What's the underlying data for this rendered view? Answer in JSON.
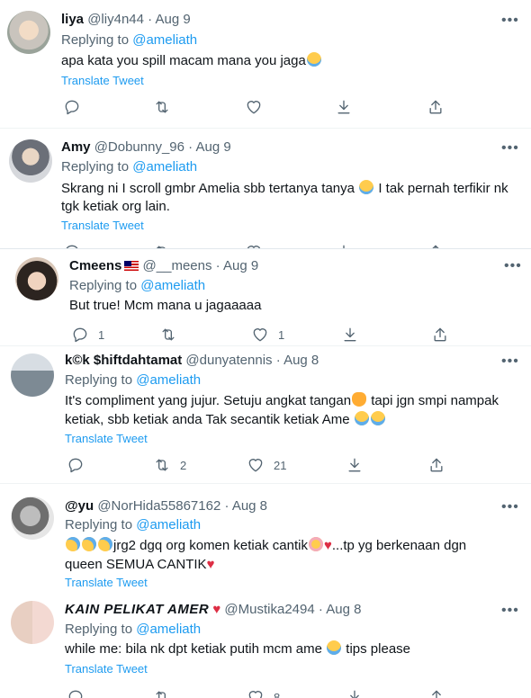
{
  "translate_label": "Translate Tweet",
  "replying_prefix": "Replying to",
  "tweets": [
    {
      "name": "liya",
      "handle": "@liy4n44",
      "date": "Aug 9",
      "mention": "@ameliath",
      "text_line1": "apa kata you spill macam mana you jaga",
      "counts": {
        "reply": "",
        "retweet": "",
        "like": ""
      }
    },
    {
      "name": "Amy",
      "handle": "@Dobunny_96",
      "date": "Aug 9",
      "mention": "@ameliath",
      "text_line1": "Skrang ni I scroll gmbr Amelia sbb tertanya tanya",
      "text_line1b": "I tak pernah terfikir nk",
      "text_line2": "tgk ketiak org lain."
    },
    {
      "name": "Cmeens",
      "handle": "@__meens",
      "date": "Aug 9",
      "mention": "@ameliath",
      "text_line1": "But true! Mcm mana u jagaaaaa",
      "counts": {
        "reply": "1",
        "retweet": "",
        "like": "1"
      }
    },
    {
      "name": "k©k $hiftdahtamat",
      "handle": "@dunyatennis",
      "date": "Aug 8",
      "mention": "@ameliath",
      "text_line1": "It's compliment yang jujur. Setuju angkat tangan",
      "text_line1b": "tapi jgn smpi nampak",
      "text_line2": "ketiak, sbb ketiak anda Tak secantik ketiak Ame",
      "counts": {
        "reply": "",
        "retweet": "2",
        "like": "21"
      }
    },
    {
      "name": "@yu",
      "handle": "@NorHida55867162",
      "date": "Aug 8",
      "mention": "@ameliath",
      "text_line1": "jrg2 dgq org komen ketiak cantik",
      "text_line1b": "...tp yg berkenaan dgn",
      "text_line2": "queen SEMUA CANTIK"
    },
    {
      "name": "KAIN PELIKAT AMER",
      "handle": "@Mustika2494",
      "date": "Aug 8",
      "mention": "@ameliath",
      "text_line1": "while me: bila nk dpt ketiak putih mcm ame",
      "text_line1b": "tips please",
      "counts": {
        "reply": "",
        "retweet": "",
        "like": "8"
      }
    }
  ],
  "colors": {
    "link": "#1d9bf0",
    "muted": "#536471",
    "text": "#0f1419"
  }
}
